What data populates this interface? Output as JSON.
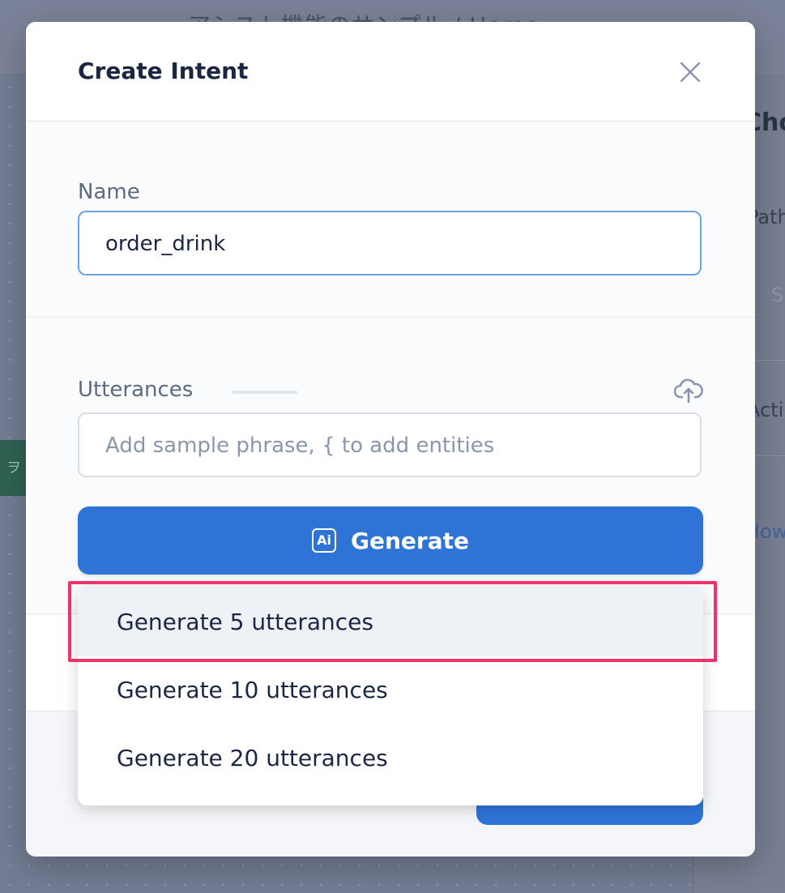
{
  "background": {
    "breadcrumb": "アシスト機能のサンプル / Home",
    "panel_heading": "Cho",
    "panel_path": "Path",
    "panel_search": "S",
    "panel_action": "Acti",
    "panel_link": "How"
  },
  "modal": {
    "title": "Create Intent",
    "name": {
      "label": "Name",
      "value": "order_drink"
    },
    "utterances": {
      "label": "Utterances",
      "placeholder": "Add sample phrase, { to add entities"
    },
    "generate_button": {
      "label": "Generate",
      "icon": "ai-icon",
      "icon_text": "Ai"
    }
  },
  "dropdown": {
    "items": [
      {
        "label": "Generate 5 utterances",
        "active": true
      },
      {
        "label": "Generate 10 utterances",
        "active": false
      },
      {
        "label": "Generate 20 utterances",
        "active": false
      }
    ]
  },
  "colors": {
    "accent": "#2e74d7",
    "highlight": "#f0326b",
    "overlay": "#737c92"
  }
}
